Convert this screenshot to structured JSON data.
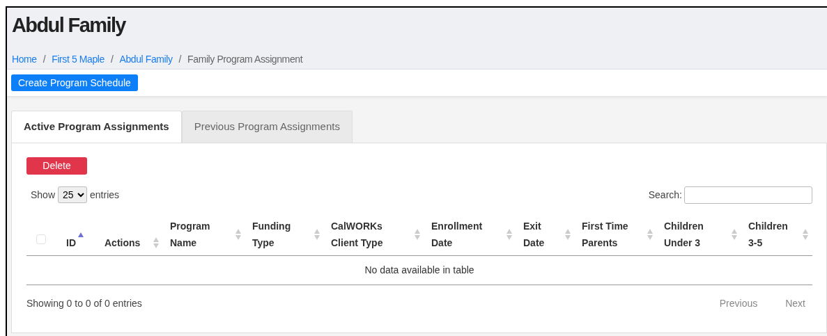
{
  "page": {
    "title": "Abdul Family"
  },
  "breadcrumb": [
    {
      "label": "Home",
      "link": true,
      "separator": "/"
    },
    {
      "label": "First 5 Maple",
      "link": true,
      "separator": "/"
    },
    {
      "label": "Abdul Family",
      "link": true,
      "separator": "/"
    },
    {
      "label": "Family Program Assignment",
      "link": false
    }
  ],
  "toolbar": {
    "button": "Create Program Schedule"
  },
  "tabs": [
    {
      "label": "Active Program Assignments",
      "selected": true
    },
    {
      "label": "Previous Program Assignments",
      "selected": false
    }
  ],
  "delete_button": "Delete",
  "length_menu": {
    "before": "Show",
    "value": "25",
    "after": "entries"
  },
  "search": {
    "label": "Search:"
  },
  "table": {
    "select_all": {
      "checked": false
    },
    "columns": [
      {
        "label": "ID",
        "sorted": true
      },
      {
        "label": "Actions",
        "sorted": false
      },
      {
        "label": "Program Name",
        "sorted": false
      },
      {
        "label": "Funding Type",
        "sorted": false
      },
      {
        "label": "CalWORKs Client Type",
        "sorted": false
      },
      {
        "label": "Enrollment Date",
        "sorted": false
      },
      {
        "label": "Exit Date",
        "sorted": false
      },
      {
        "label": "First Time Parents",
        "sorted": false
      },
      {
        "label": "Children Under 3",
        "sorted": false
      },
      {
        "label": "Children 3-5",
        "sorted": false
      }
    ],
    "empty_message": "No data available in table"
  },
  "info": "Showing 0 to 0 of 0 entries",
  "pagination": [
    {
      "label": "Previous",
      "disabled": true
    },
    {
      "label": "Next",
      "disabled": true
    }
  ]
}
